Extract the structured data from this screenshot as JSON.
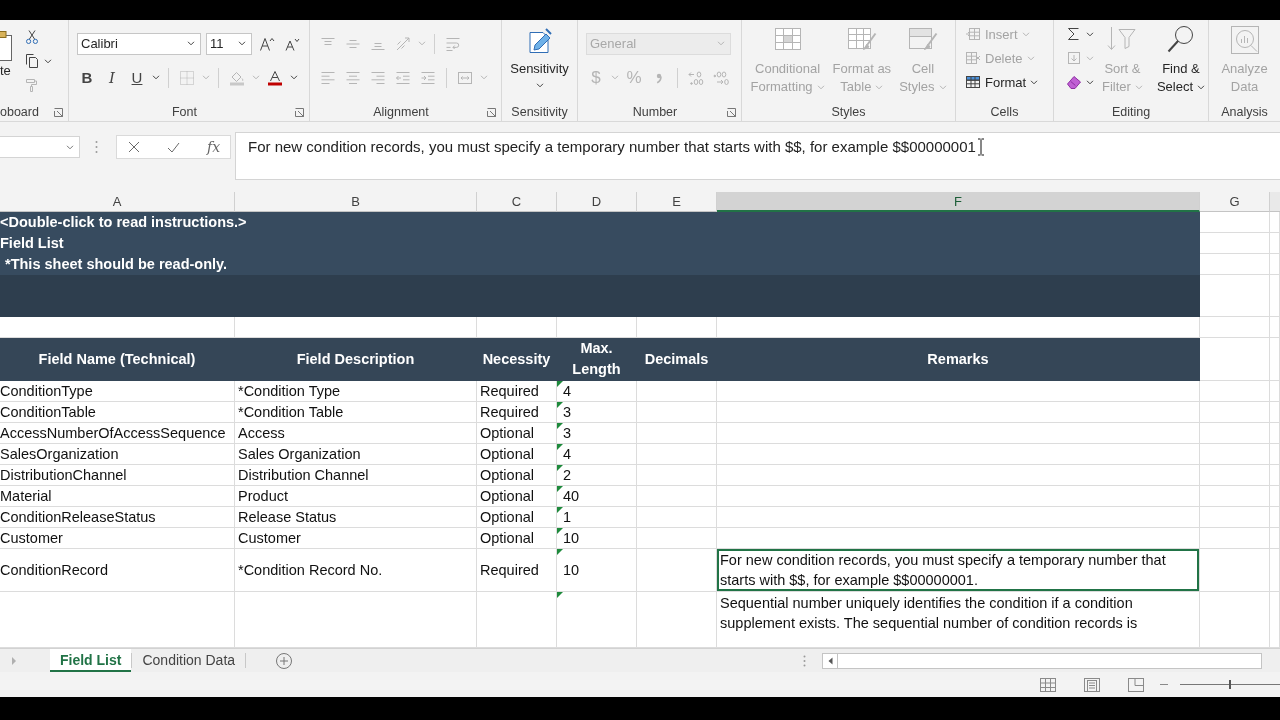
{
  "ribbon": [
    {
      "kind": "clipboard",
      "label": "oboard",
      "launcher": true,
      "paste": {
        "label": "te",
        "disabled": false
      },
      "tools": [
        {
          "kind": "cut",
          "disabled": false,
          "menu": false
        },
        {
          "kind": "copy",
          "disabled": false,
          "menu": true
        },
        {
          "kind": "painter",
          "disabled": true,
          "menu": false
        }
      ]
    },
    {
      "kind": "rows",
      "label": "Font",
      "launcher": true,
      "toolbars": [
        {
          "tools": [
            {
              "kind": "font_combo",
              "value": "Calibri",
              "disabled": false
            },
            {
              "kind": "size_combo",
              "value": "11",
              "disabled": false
            },
            {
              "kind": "grow",
              "disabled": false,
              "menu": false
            },
            {
              "kind": "shrink",
              "disabled": false,
              "menu": false
            }
          ]
        },
        {
          "tools": [
            {
              "kind": "bold",
              "label": "B",
              "disabled": false,
              "menu": false
            },
            {
              "kind": "italic",
              "label": "I",
              "disabled": false,
              "menu": false
            },
            {
              "kind": "underline",
              "label": "U",
              "disabled": false,
              "menu": true
            },
            {
              "kind": "sep"
            },
            {
              "kind": "borders",
              "disabled": true,
              "menu": true
            },
            {
              "kind": "sep"
            },
            {
              "kind": "fill",
              "disabled": true,
              "menu": true
            },
            {
              "kind": "font_color",
              "disabled": false,
              "menu": true
            }
          ]
        }
      ]
    },
    {
      "kind": "rows",
      "label": "Alignment",
      "launcher": true,
      "toolbars": [
        {
          "tools": [
            {
              "kind": "align_top",
              "disabled": true,
              "menu": false
            },
            {
              "kind": "align_middle",
              "disabled": true,
              "menu": false
            },
            {
              "kind": "align_bottom",
              "disabled": true,
              "menu": false
            },
            {
              "kind": "orientation",
              "disabled": true,
              "menu": true
            },
            {
              "kind": "sep"
            },
            {
              "kind": "wrap",
              "disabled": true,
              "menu": false
            }
          ]
        },
        {
          "tools": [
            {
              "kind": "align_left",
              "disabled": true,
              "menu": false
            },
            {
              "kind": "align_center",
              "disabled": true,
              "menu": false
            },
            {
              "kind": "align_right",
              "disabled": true,
              "menu": false
            },
            {
              "kind": "outdent",
              "disabled": true,
              "menu": false
            },
            {
              "kind": "indent",
              "disabled": true,
              "menu": false
            },
            {
              "kind": "sep"
            },
            {
              "kind": "merge",
              "disabled": true,
              "menu": true
            }
          ]
        }
      ]
    },
    {
      "kind": "big",
      "label": "Sensitivity",
      "launcher": false,
      "buttons": [
        {
          "kind": "sensitivity",
          "lines": [
            "Sensitivity"
          ],
          "disabled": false,
          "menu": true
        }
      ]
    },
    {
      "kind": "rows",
      "label": "Number",
      "launcher": true,
      "toolbars": [
        {
          "tools": [
            {
              "kind": "format_combo",
              "value": "General",
              "disabled": true
            }
          ]
        },
        {
          "tools": [
            {
              "kind": "currency",
              "label": "$",
              "disabled": true,
              "menu": true
            },
            {
              "kind": "percent",
              "label": "%",
              "disabled": true,
              "menu": false
            },
            {
              "kind": "comma",
              "disabled": true,
              "menu": false
            },
            {
              "kind": "sep"
            },
            {
              "kind": "inc_decimal",
              "disabled": true,
              "menu": false
            },
            {
              "kind": "dec_decimal",
              "disabled": true,
              "menu": false
            }
          ]
        }
      ]
    },
    {
      "kind": "big",
      "label": "Styles",
      "launcher": false,
      "buttons": [
        {
          "kind": "conditional",
          "lines": [
            "Conditional",
            "Formatting"
          ],
          "disabled": true,
          "menu": true
        },
        {
          "kind": "table_format",
          "lines": [
            "Format as",
            "Table"
          ],
          "disabled": true,
          "menu": true
        },
        {
          "kind": "cell_styles",
          "lines": [
            "Cell",
            "Styles"
          ],
          "disabled": true,
          "menu": true
        }
      ]
    },
    {
      "kind": "stack",
      "label": "Cells",
      "launcher": false,
      "tools": [
        {
          "kind": "insert",
          "label": "Insert",
          "disabled": true,
          "menu": true
        },
        {
          "kind": "delete",
          "label": "Delete",
          "disabled": true,
          "menu": true
        },
        {
          "kind": "format",
          "label": "Format",
          "disabled": false,
          "menu": true
        }
      ]
    },
    {
      "kind": "mixed",
      "label": "Editing",
      "launcher": false,
      "tools": [
        {
          "kind": "autosum",
          "disabled": false,
          "menu": true
        },
        {
          "kind": "fill_down",
          "disabled": true,
          "menu": true
        },
        {
          "kind": "clear",
          "disabled": false,
          "menu": true
        }
      ],
      "buttons": [
        {
          "kind": "sort_filter",
          "lines": [
            "Sort &",
            "Filter"
          ],
          "disabled": true,
          "menu": true
        },
        {
          "kind": "find",
          "lines": [
            "Find &",
            "Select"
          ],
          "disabled": false,
          "menu": true
        }
      ]
    },
    {
      "kind": "big",
      "label": "Analysis",
      "launcher": false,
      "buttons": [
        {
          "kind": "analyze",
          "lines": [
            "Analyze",
            "Data"
          ],
          "disabled": true,
          "menu": false
        }
      ]
    }
  ],
  "formula_bar": {
    "function_label": "fx",
    "formula": "For new condition records, you must specify a temporary number that starts with $$, for example $$00000001"
  },
  "sheet": {
    "columns": [
      {
        "label": "A",
        "selected": false
      },
      {
        "label": "B",
        "selected": false
      },
      {
        "label": "C",
        "selected": false
      },
      {
        "label": "D",
        "selected": false
      },
      {
        "label": "E",
        "selected": false
      },
      {
        "label": "F",
        "selected": true
      },
      {
        "label": "G",
        "selected": false
      }
    ],
    "banner": {
      "instruction": "<Double-click to read instructions.>",
      "title": "Field List",
      "note": "*This sheet should be read-only."
    },
    "header": [
      "Field Name (Technical)",
      "Field Description",
      "Necessity",
      "Max. Length",
      "Decimals",
      "Remarks"
    ],
    "rows": [
      {
        "field_name": "ConditionType",
        "description": "*Condition Type",
        "necessity": "Required",
        "max_length": "4",
        "flag": true,
        "selected": false
      },
      {
        "field_name": "ConditionTable",
        "description": "*Condition Table",
        "necessity": "Required",
        "max_length": "3",
        "flag": true,
        "selected": false
      },
      {
        "field_name": "AccessNumberOfAccessSequence",
        "description": "Access",
        "necessity": "Optional",
        "max_length": "3",
        "flag": true,
        "selected": false
      },
      {
        "field_name": "SalesOrganization",
        "description": "Sales Organization",
        "necessity": "Optional",
        "max_length": "4",
        "flag": true,
        "selected": false
      },
      {
        "field_name": "DistributionChannel",
        "description": "Distribution Channel",
        "necessity": "Optional",
        "max_length": "2",
        "flag": true,
        "selected": false
      },
      {
        "field_name": "Material",
        "description": "Product",
        "necessity": "Optional",
        "max_length": "40",
        "flag": true,
        "selected": false
      },
      {
        "field_name": "ConditionReleaseStatus",
        "description": "Release Status",
        "necessity": "Optional",
        "max_length": "1",
        "flag": true,
        "selected": false
      },
      {
        "field_name": "Customer",
        "description": "Customer",
        "necessity": "Optional",
        "max_length": "10",
        "flag": true,
        "selected": false
      },
      {
        "field_name": "ConditionRecord",
        "description": "*Condition Record No.",
        "necessity": "Required",
        "max_length": "10",
        "remarks": "For new condition records, you must specify a temporary number that starts with $$, for example $$00000001.",
        "flag": true,
        "selected": true
      },
      {
        "remarks": "Sequential number uniquely identifies the condition if a condition supplement exists. The sequential number of condition records is",
        "flag": true,
        "selected": false
      }
    ]
  },
  "sheet_tabs": [
    {
      "label": "Field List",
      "selected": true
    },
    {
      "label": "Condition Data",
      "selected": false
    }
  ],
  "status": {
    "zoom": {
      "level": 0.5
    }
  }
}
